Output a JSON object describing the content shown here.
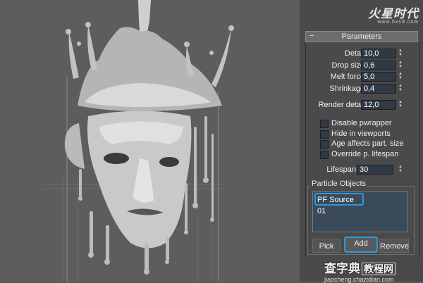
{
  "logo": {
    "brand": "火星时代",
    "url": "www.hxsd.com"
  },
  "rollout": {
    "collapse_symbol": "−",
    "title": "Parameters"
  },
  "params": [
    {
      "label": "Detail",
      "value": "10,0"
    },
    {
      "label": "Drop size",
      "value": "0,6"
    },
    {
      "label": "Melt force",
      "value": "5,0"
    },
    {
      "label": "Shrinkage",
      "value": "0,4"
    }
  ],
  "render_detail": {
    "label": "Render detail",
    "value": "12,0"
  },
  "checkboxes": [
    {
      "label": "Disable pwrapper",
      "checked": false
    },
    {
      "label": "Hide in viewports",
      "checked": false
    },
    {
      "label": "Age affects part. size",
      "checked": false
    },
    {
      "label": "Override p. lifespan",
      "checked": false
    }
  ],
  "lifespan": {
    "label": "Lifespan",
    "value": "30"
  },
  "particle_objects": {
    "group_label": "Particle Objects",
    "items": [
      "PF Source 01"
    ],
    "pick_label": "Pick",
    "add_label": "Add",
    "remove_label": "Remove"
  },
  "watermark": {
    "main": "查字典",
    "sub": "教程网",
    "site": "jiaocheng.chazidian.com"
  },
  "colors": {
    "highlight": "#2a9ae0",
    "field_bg": "#2f3a45",
    "panel_bg": "#4a4a4a",
    "viewport_bg": "#5d5d5d"
  }
}
